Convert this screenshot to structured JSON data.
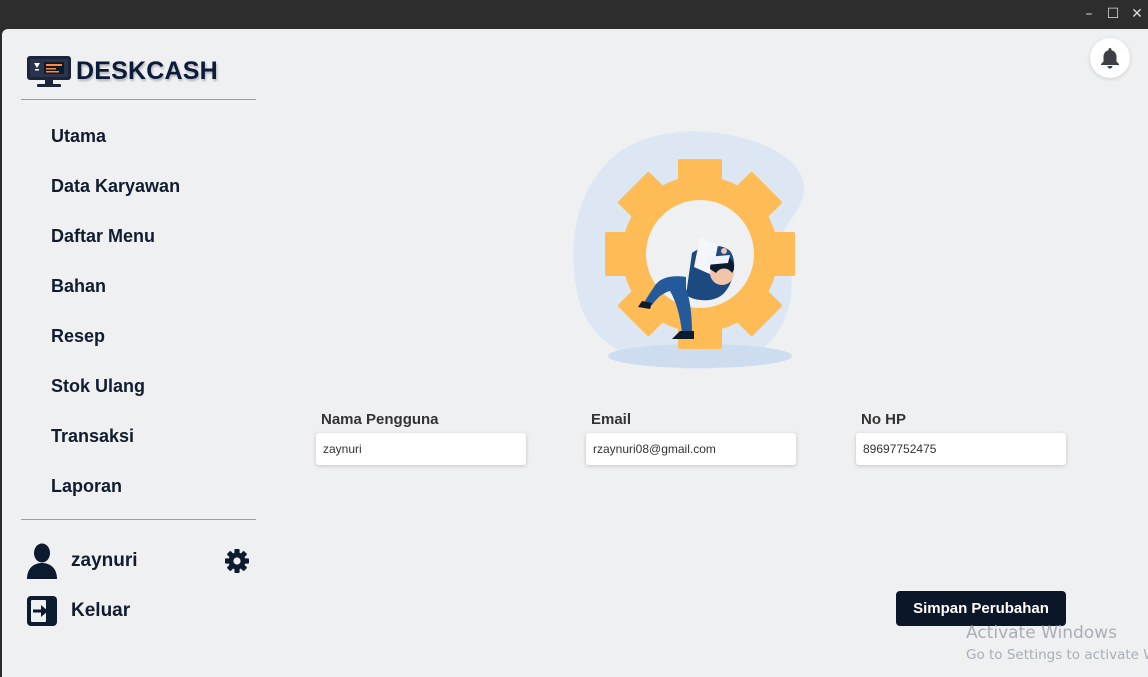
{
  "window": {
    "minimize": "–",
    "maximize": "☐",
    "close": "✕"
  },
  "brand": {
    "name": "DESKCASH",
    "logo_icon": "monitor-logo-icon"
  },
  "nav": {
    "items": [
      {
        "label": "Utama"
      },
      {
        "label": "Data Karyawan"
      },
      {
        "label": "Daftar Menu"
      },
      {
        "label": "Bahan"
      },
      {
        "label": "Resep"
      },
      {
        "label": "Stok Ulang"
      },
      {
        "label": "Transaksi"
      },
      {
        "label": "Laporan"
      }
    ]
  },
  "user": {
    "name": "zaynuri",
    "avatar_icon": "user-silhouette-icon",
    "settings_icon": "gear-icon"
  },
  "logout": {
    "label": "Keluar",
    "icon": "logout-icon"
  },
  "notification": {
    "icon": "bell-icon"
  },
  "form": {
    "username": {
      "label": "Nama Pengguna",
      "value": "zaynuri"
    },
    "email": {
      "label": "Email",
      "value": "rzaynuri08@gmail.com"
    },
    "phone": {
      "label": "No HP",
      "value": "89697752475"
    }
  },
  "save_button": "Simpan Perubahan",
  "watermark": {
    "title": "Activate Windows",
    "subtitle": "Go to Settings to activate Windows."
  },
  "colors": {
    "accent_dark": "#0b1628",
    "gear_yellow": "#ffbb55",
    "blob_blue": "#dce7f3"
  }
}
